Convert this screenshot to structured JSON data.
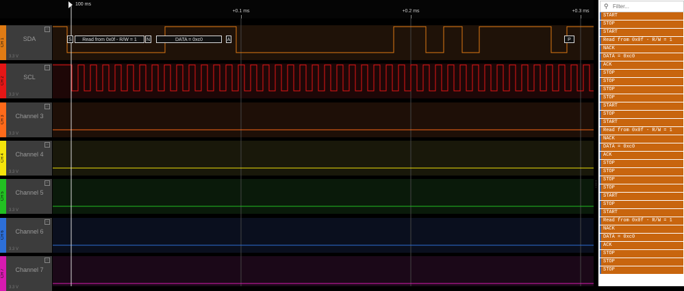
{
  "timeline": {
    "cursor_label": "100 ms",
    "ticks": [
      "+0.1 ms",
      "+0.2 ms",
      "+0.3 ms"
    ]
  },
  "channels": [
    {
      "tab": "CH 1",
      "name": "SDA",
      "voltage": "3.3 V",
      "color": "#e07b14",
      "bg": "#1f1208"
    },
    {
      "tab": "CH 2",
      "name": "SCL",
      "voltage": "3.3 V",
      "color": "#e51616",
      "bg": "#1e0707"
    },
    {
      "tab": "CH 3",
      "name": "Channel 3",
      "voltage": "3.3 V",
      "color": "#ff6a1a",
      "bg": "#1e0f07"
    },
    {
      "tab": "CH 4",
      "name": "Channel 4",
      "voltage": "3.3 V",
      "color": "#f4e40b",
      "bg": "#19180a"
    },
    {
      "tab": "CH 5",
      "name": "Channel 5",
      "voltage": "3.3 V",
      "color": "#22c022",
      "bg": "#0a1a0a"
    },
    {
      "tab": "CH 6",
      "name": "Channel 6",
      "voltage": "3.3 V",
      "color": "#2d6fd8",
      "bg": "#0a0f1e"
    },
    {
      "tab": "CH 7",
      "name": "Channel 7",
      "voltage": "3.3 V",
      "color": "#d81ab0",
      "bg": "#1b0818"
    }
  ],
  "decoder": {
    "start": "S",
    "address": "Read from 0x0f - R/W = 1",
    "nack": "N",
    "data": "DATA = 0xc0",
    "ack": "A",
    "stop": "P"
  },
  "filter": {
    "placeholder": "Filter..."
  },
  "results": [
    "START",
    "STOP",
    "START",
    "Read from 0x0f - R/W = 1",
    "NACK",
    "DATA = 0xc0",
    "ACK",
    "STOP",
    "STOP",
    "STOP",
    "STOP",
    "START",
    "STOP",
    "START",
    "Read from 0x0f - R/W = 1",
    "NACK",
    "DATA = 0xc0",
    "ACK",
    "STOP",
    "STOP",
    "STOP",
    "STOP",
    "START",
    "STOP",
    "START",
    "Read from 0x0f - R/W = 1",
    "NACK",
    "DATA = 0xc0",
    "ACK",
    "STOP",
    "STOP",
    "STOP"
  ]
}
